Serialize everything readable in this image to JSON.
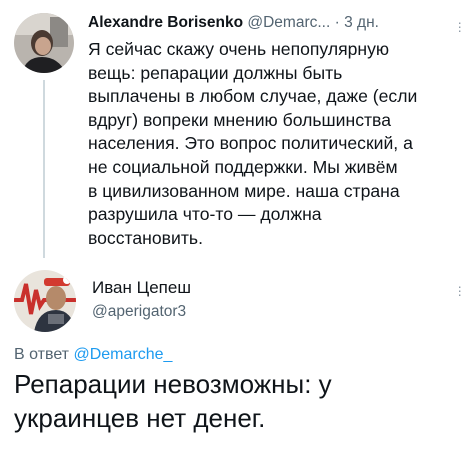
{
  "reply_tweet_parent": {
    "author_name": "Alexandre Borisenko",
    "author_handle": "@Demarc...",
    "separator": "·",
    "time": "3 дн.",
    "text_lines": [
      "Я сейчас скажу очень непопулярную",
      "вещь: репарации должны быть",
      "выплачены в любом случае, даже (если",
      "вдруг) вопреки мнению большинства",
      "населения. Это вопрос политический, а",
      "не социальной поддержки. Мы живём",
      "в цивилизованном мире. наша страна",
      "разрушила что-то — должна",
      "восстановить."
    ]
  },
  "reply_tweet": {
    "author_name": "Иван Цепеш",
    "author_handle": "@aperigator3",
    "reply_prefix": "В ответ",
    "reply_mention": "@Demarche_",
    "text_lines": [
      "Репарации невозможны: у",
      "украинцев нет денег."
    ]
  },
  "colors": {
    "text": "#0f1419",
    "muted": "#536471",
    "link": "#1d9bf0",
    "thread_line": "#cfd9de"
  },
  "icons": {
    "more": "more-vertical-icon"
  }
}
